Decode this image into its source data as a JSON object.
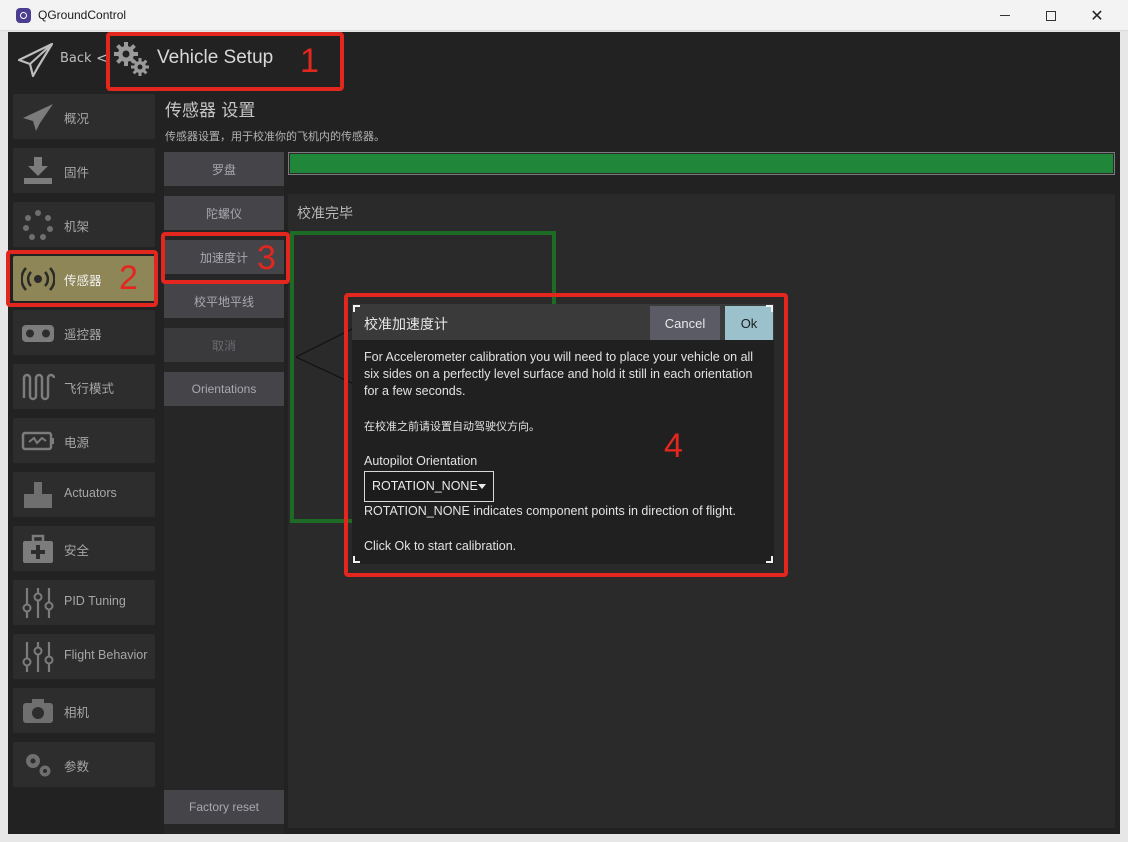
{
  "window": {
    "title": "QGroundControl",
    "minimize_icon": "minimize-icon",
    "maximize_icon": "maximize-icon",
    "close_glyph": "✕"
  },
  "toolbar": {
    "back_label": "Back",
    "back_chevron": "<",
    "title": "Vehicle Setup"
  },
  "annotations": [
    "1",
    "2",
    "3",
    "4"
  ],
  "sidebar": {
    "items": [
      {
        "label": "概况",
        "icon": "plane-icon"
      },
      {
        "label": "固件",
        "icon": "download-icon"
      },
      {
        "label": "机架",
        "icon": "airframe-icon"
      },
      {
        "label": "传感器",
        "icon": "sensors-icon",
        "active": true
      },
      {
        "label": "遥控器",
        "icon": "radio-icon"
      },
      {
        "label": "飞行模式",
        "icon": "flight-modes-icon"
      },
      {
        "label": "电源",
        "icon": "power-icon"
      },
      {
        "label": "Actuators",
        "icon": "actuators-icon"
      },
      {
        "label": "安全",
        "icon": "safety-icon"
      },
      {
        "label": "PID Tuning",
        "icon": "sliders-icon"
      },
      {
        "label": "Flight Behavior",
        "icon": "sliders-icon"
      },
      {
        "label": "相机",
        "icon": "camera-icon"
      },
      {
        "label": "参数",
        "icon": "gears-icon"
      }
    ]
  },
  "main": {
    "title": "传感器 设置",
    "subtitle": "传感器设置，用于校准你的飞机内的传感器。",
    "sensor_buttons": [
      {
        "label": "罗盘"
      },
      {
        "label": "陀螺仪"
      },
      {
        "label": "加速度计"
      },
      {
        "label": "校平地平线"
      },
      {
        "label": "取消",
        "disabled": true
      },
      {
        "label": "Orientations"
      }
    ],
    "factory_reset": "Factory reset",
    "progress": 1.0,
    "progress_color": "#20873a",
    "calibration_status": "校准完毕"
  },
  "dialog": {
    "title": "校准加速度计",
    "cancel_label": "Cancel",
    "ok_label": "Ok",
    "body_lines": [
      "For Accelerometer calibration you will need to place your vehicle on all",
      "six sides on a perfectly level surface and hold it still in each orientation",
      "for a few seconds."
    ],
    "zh_note": "在校准之前请设置自动驾驶仪方向。",
    "orientation_label": "Autopilot Orientation",
    "orientation_value": "ROTATION_NONE",
    "orientation_note": "ROTATION_NONE indicates component points in direction of flight.",
    "start_note": "Click Ok to start calibration."
  },
  "colors": {
    "annotation": "#e3261e",
    "active_item": "#8e8656",
    "ok_button": "#9bc2cc",
    "green_outline": "#1d6b25"
  }
}
